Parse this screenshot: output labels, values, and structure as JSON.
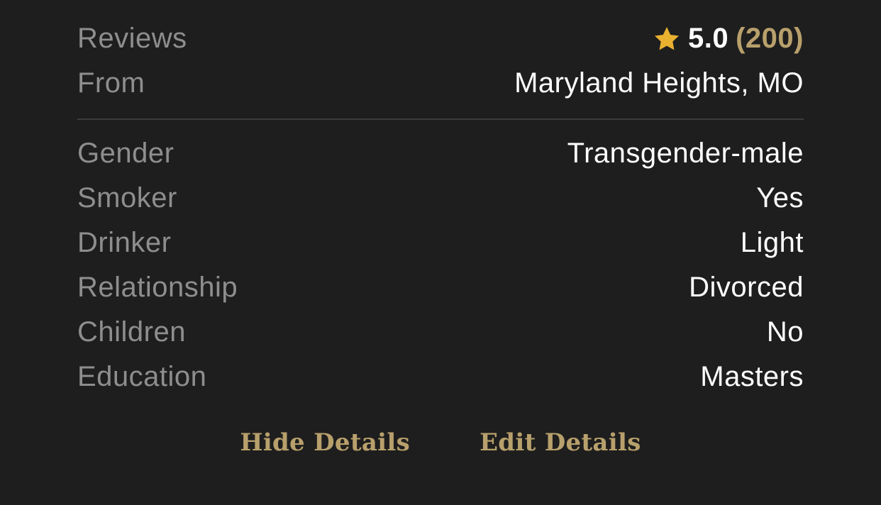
{
  "header": {
    "reviews_label": "Reviews",
    "rating_score": "5.0",
    "rating_count": "(200)",
    "star_icon": "star-icon",
    "star_color": "#e8b130",
    "from_label": "From",
    "from_value": "Maryland Heights, MO"
  },
  "details": [
    {
      "label": "Gender",
      "value": "Transgender-male"
    },
    {
      "label": "Smoker",
      "value": "Yes"
    },
    {
      "label": "Drinker",
      "value": "Light"
    },
    {
      "label": "Relationship",
      "value": "Divorced"
    },
    {
      "label": "Children",
      "value": "No"
    },
    {
      "label": "Education",
      "value": "Masters"
    }
  ],
  "actions": {
    "hide_label": "Hide Details",
    "edit_label": "Edit Details",
    "accent_color": "#b8a06c"
  }
}
